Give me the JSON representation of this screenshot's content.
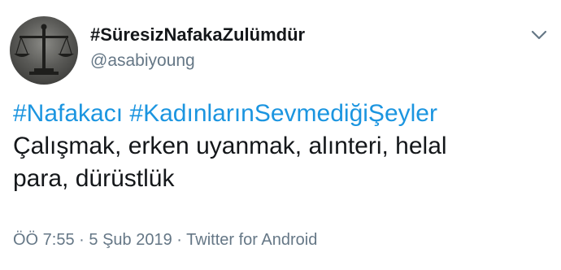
{
  "tweet": {
    "display_name": "#SüresizNafakaZulümdür",
    "handle": "@asabiyoung",
    "hashtags": [
      "#Nafakacı",
      "#KadınlarınSevmediğiŞeyler"
    ],
    "body_line1": "Çalışmak, erken uyanmak, alınteri, helal",
    "body_line2": "para, dürüstlük",
    "time": "ÖÖ 7:55",
    "separator": "·",
    "date": "5 Şub 2019",
    "source": "Twitter for Android"
  },
  "icons": {
    "avatar": "scales-of-justice-avatar",
    "menu": "chevron-down-icon"
  },
  "colors": {
    "link": "#1b95e0",
    "secondary_text": "#657786",
    "primary_text": "#14171a"
  }
}
